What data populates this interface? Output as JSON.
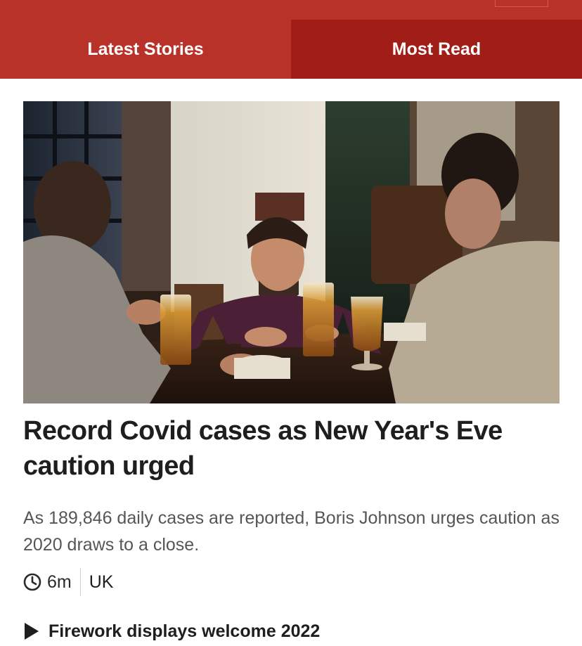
{
  "tabs": {
    "latest_label": "Latest Stories",
    "most_read_label": "Most Read"
  },
  "article": {
    "image_alt": "Three men drinking beer at a pub table",
    "headline": "Record Covid cases as New Year's Eve caution urged",
    "summary": "As 189,846 daily cases are reported, Boris Johnson urges caution as 2020 draws to a close.",
    "time_ago": "6m",
    "section": "UK"
  },
  "related": {
    "link_label": "Firework displays welcome 2022"
  },
  "colors": {
    "tab_active": "#b9322a",
    "tab_other": "#a11d17",
    "headline": "#1e1e1e",
    "summary": "#545658"
  },
  "icons": {
    "clock": "clock-icon",
    "play": "play-icon"
  }
}
